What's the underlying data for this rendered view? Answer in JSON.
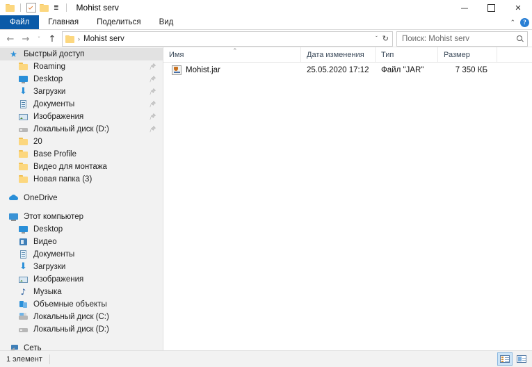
{
  "window": {
    "title": "Mohist serv",
    "quick_access_toolbar": [
      {
        "name": "folder-icon",
        "label": ""
      },
      {
        "name": "properties-icon",
        "label": ""
      },
      {
        "name": "new-folder-icon",
        "label": ""
      },
      {
        "name": "customize-chevron-icon",
        "label": "≡"
      }
    ],
    "controls": {
      "minimize": "—",
      "maximize": "☐",
      "close": "✕"
    }
  },
  "ribbon": {
    "tabs": [
      {
        "label": "Файл",
        "active": true
      },
      {
        "label": "Главная",
        "active": false
      },
      {
        "label": "Поделиться",
        "active": false
      },
      {
        "label": "Вид",
        "active": false
      }
    ],
    "collapse_chevron": "⌃",
    "help_label": "?"
  },
  "address": {
    "back_arrow": "←",
    "forward_arrow": "→",
    "recent_chevron": "ˇ",
    "up_arrow": "↑",
    "breadcrumb_separator": "›",
    "breadcrumb": [
      "Mohist serv"
    ],
    "dropdown_chevron": "ˇ",
    "refresh_icon": "↻"
  },
  "search": {
    "placeholder": "Поиск: Mohist serv"
  },
  "sidebar": {
    "groups": [
      {
        "header": {
          "label": "Быстрый доступ",
          "icon": "star-icon",
          "selected": true
        },
        "items": [
          {
            "label": "Roaming",
            "icon": "folder-icon",
            "pinned": true
          },
          {
            "label": "Desktop",
            "icon": "desktop-icon",
            "pinned": true
          },
          {
            "label": "Загрузки",
            "icon": "downloads-icon",
            "pinned": true
          },
          {
            "label": "Документы",
            "icon": "documents-icon",
            "pinned": true
          },
          {
            "label": "Изображения",
            "icon": "pictures-icon",
            "pinned": true
          },
          {
            "label": "Локальный диск (D:)",
            "icon": "drive-icon",
            "pinned": true
          },
          {
            "label": "20",
            "icon": "folder-icon",
            "pinned": false
          },
          {
            "label": "Base Profile",
            "icon": "folder-icon",
            "pinned": false
          },
          {
            "label": "Видео для монтажа",
            "icon": "folder-icon",
            "pinned": false
          },
          {
            "label": "Новая папка (3)",
            "icon": "folder-icon",
            "pinned": false
          }
        ]
      },
      {
        "header": {
          "label": "OneDrive",
          "icon": "cloud-icon",
          "selected": false
        },
        "items": []
      },
      {
        "header": {
          "label": "Этот компьютер",
          "icon": "this-pc-icon",
          "selected": false
        },
        "items": [
          {
            "label": "Desktop",
            "icon": "desktop-icon",
            "pinned": false
          },
          {
            "label": "Видео",
            "icon": "video-icon",
            "pinned": false
          },
          {
            "label": "Документы",
            "icon": "documents-icon",
            "pinned": false
          },
          {
            "label": "Загрузки",
            "icon": "downloads-icon",
            "pinned": false
          },
          {
            "label": "Изображения",
            "icon": "pictures-icon",
            "pinned": false
          },
          {
            "label": "Музыка",
            "icon": "music-icon",
            "pinned": false
          },
          {
            "label": "Объемные объекты",
            "icon": "3d-objects-icon",
            "pinned": false
          },
          {
            "label": "Локальный диск (C:)",
            "icon": "system-drive-icon",
            "pinned": false
          },
          {
            "label": "Локальный диск (D:)",
            "icon": "drive-icon",
            "pinned": false
          }
        ]
      },
      {
        "header": {
          "label": "Сеть",
          "icon": "network-icon",
          "selected": false
        },
        "items": []
      }
    ]
  },
  "filelist": {
    "columns": [
      {
        "label": "Имя",
        "sorted": true,
        "sort_marker": "⌃"
      },
      {
        "label": "Дата изменения",
        "sorted": false
      },
      {
        "label": "Тип",
        "sorted": false
      },
      {
        "label": "Размер",
        "sorted": false
      }
    ],
    "rows": [
      {
        "icon": "jar-file-icon",
        "name": "Mohist.jar",
        "date": "25.05.2020 17:12",
        "type": "Файл \"JAR\"",
        "size": "7 350 КБ"
      }
    ]
  },
  "statusbar": {
    "item_count": "1 элемент",
    "views": [
      {
        "name": "details-view-button",
        "active": true
      },
      {
        "name": "large-icons-view-button",
        "active": false
      }
    ]
  },
  "colors": {
    "accent": "#0a5aa8",
    "sidebar_bg": "#f2f2f2",
    "selection": "#e2e2e2",
    "folder": "#fcd77f"
  }
}
